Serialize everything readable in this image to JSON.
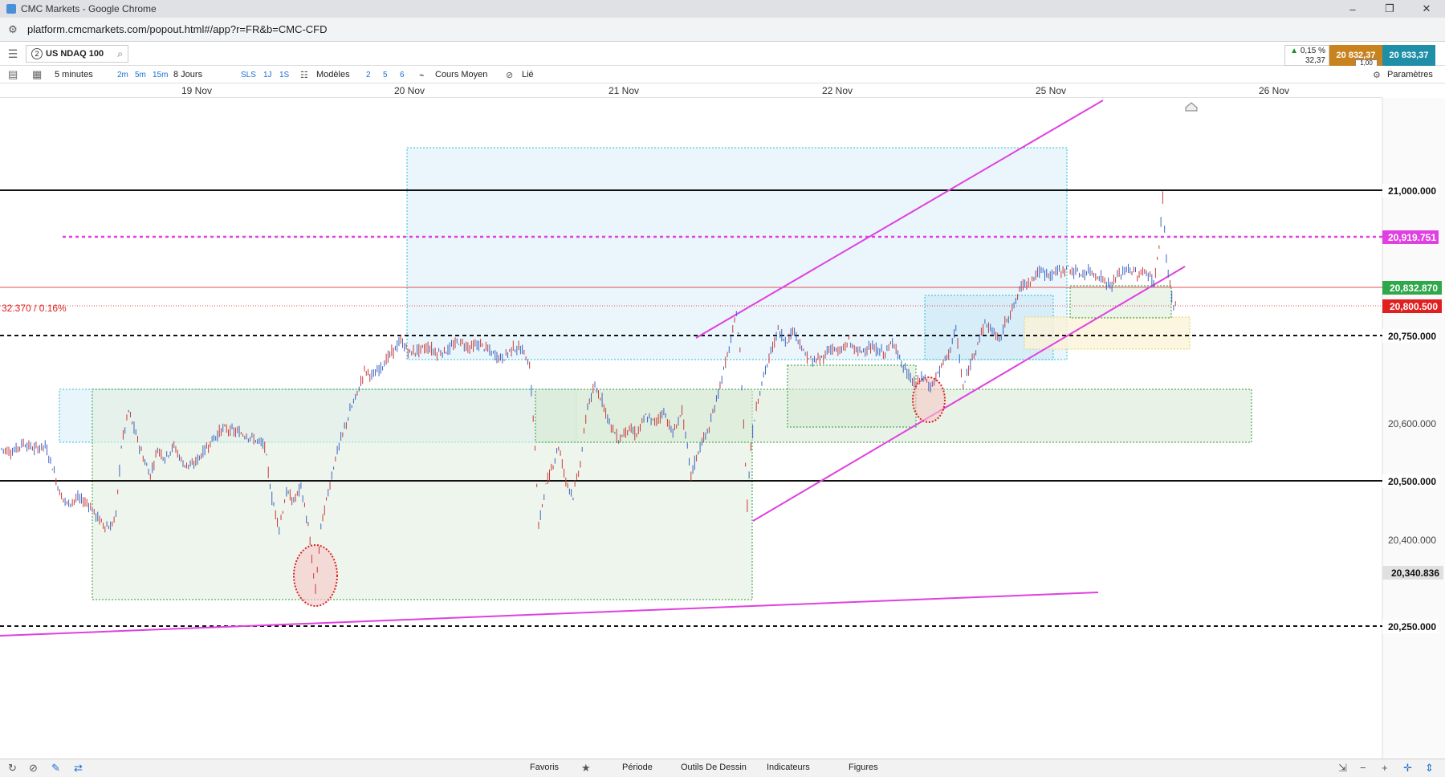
{
  "window": {
    "title": "CMC Markets - Google Chrome"
  },
  "browser": {
    "url": "platform.cmcmarkets.com/popout.html#/app?r=FR&b=CMC-CFD"
  },
  "instrument": {
    "badge": "2",
    "symbol": "US NDAQ 100"
  },
  "quote": {
    "change_pct": "0,15 %",
    "change_abs": "32,37",
    "sell": "20 832,37",
    "buy": "20 833,37",
    "spread": "1,00",
    "colors": {
      "up": "#1a8f2a",
      "sell": "#c8831e",
      "buy": "#1f8fa8"
    }
  },
  "toolbar": {
    "interval": "5 minutes",
    "quick_intervals": [
      "2m",
      "5m",
      "15m"
    ],
    "range": "8 Jours",
    "quick_ranges": [
      "SLS",
      "1J",
      "1S"
    ],
    "templates": "Modèles",
    "layouts": [
      "2",
      "5",
      "6"
    ],
    "price_type": "Cours Moyen",
    "linked": "Lié",
    "settings": "Paramètres"
  },
  "date_axis": [
    "19 Nov",
    "20 Nov",
    "21 Nov",
    "22 Nov",
    "25 Nov",
    "26 Nov"
  ],
  "chart_data": {
    "type": "candlestick",
    "xlabel": "",
    "ylabel": "",
    "x_ticks": [
      "19 Nov",
      "20 Nov",
      "21 Nov",
      "22 Nov",
      "25 Nov",
      "26 Nov"
    ],
    "y_ticks": [
      20400,
      20500,
      20600
    ],
    "ylim": [
      20235,
      21100
    ],
    "price_labels": [
      {
        "value": "21,000.000",
        "style": "black-line"
      },
      {
        "value": "20,919.751",
        "style": "magenta-dashed"
      },
      {
        "value": "20,832.870",
        "style": "green-current"
      },
      {
        "value": "20,800.500",
        "style": "red-reference"
      },
      {
        "value": "20,750.000",
        "style": "black-dashed"
      },
      {
        "value": "20,600.000",
        "style": "tick"
      },
      {
        "value": "20,500.000",
        "style": "black-line"
      },
      {
        "value": "20,400.000",
        "style": "tick"
      },
      {
        "value": "20,340.836",
        "style": "gray-marker"
      },
      {
        "value": "20,250.000",
        "style": "black-dashed"
      }
    ],
    "change_annotation": "32.370 / 0.16%",
    "series": [
      {
        "values": [
          [
            0,
            20555
          ],
          [
            12,
            20550
          ],
          [
            24,
            20565
          ],
          [
            36,
            20555
          ],
          [
            48,
            20560
          ],
          [
            56,
            20525
          ],
          [
            64,
            20480
          ],
          [
            72,
            20460
          ],
          [
            84,
            20470
          ],
          [
            96,
            20460
          ],
          [
            104,
            20440
          ],
          [
            112,
            20425
          ],
          [
            120,
            20420
          ],
          [
            126,
            20440
          ],
          [
            132,
            20560
          ],
          [
            140,
            20620
          ],
          [
            148,
            20580
          ],
          [
            156,
            20540
          ],
          [
            164,
            20510
          ],
          [
            172,
            20555
          ],
          [
            180,
            20540
          ],
          [
            190,
            20560
          ],
          [
            200,
            20530
          ],
          [
            210,
            20525
          ],
          [
            220,
            20545
          ],
          [
            232,
            20570
          ],
          [
            244,
            20590
          ],
          [
            256,
            20585
          ],
          [
            268,
            20580
          ],
          [
            280,
            20570
          ],
          [
            290,
            20560
          ],
          [
            298,
            20470
          ],
          [
            306,
            20420
          ],
          [
            314,
            20480
          ],
          [
            322,
            20465
          ],
          [
            330,
            20490
          ],
          [
            338,
            20420
          ],
          [
            346,
            20310
          ],
          [
            352,
            20420
          ],
          [
            360,
            20480
          ],
          [
            368,
            20540
          ],
          [
            376,
            20580
          ],
          [
            384,
            20620
          ],
          [
            392,
            20650
          ],
          [
            400,
            20690
          ],
          [
            410,
            20680
          ],
          [
            420,
            20700
          ],
          [
            430,
            20720
          ],
          [
            440,
            20740
          ],
          [
            450,
            20720
          ],
          [
            460,
            20725
          ],
          [
            470,
            20730
          ],
          [
            480,
            20720
          ],
          [
            492,
            20725
          ],
          [
            504,
            20740
          ],
          [
            516,
            20730
          ],
          [
            528,
            20735
          ],
          [
            540,
            20720
          ],
          [
            552,
            20710
          ],
          [
            564,
            20730
          ],
          [
            574,
            20725
          ],
          [
            582,
            20700
          ],
          [
            588,
            20560
          ],
          [
            592,
            20420
          ],
          [
            598,
            20480
          ],
          [
            606,
            20520
          ],
          [
            614,
            20560
          ],
          [
            622,
            20500
          ],
          [
            630,
            20475
          ],
          [
            638,
            20530
          ],
          [
            646,
            20630
          ],
          [
            654,
            20660
          ],
          [
            662,
            20640
          ],
          [
            670,
            20600
          ],
          [
            680,
            20570
          ],
          [
            690,
            20590
          ],
          [
            700,
            20580
          ],
          [
            710,
            20610
          ],
          [
            720,
            20600
          ],
          [
            730,
            20620
          ],
          [
            740,
            20580
          ],
          [
            750,
            20620
          ],
          [
            760,
            20510
          ],
          [
            770,
            20560
          ],
          [
            780,
            20590
          ],
          [
            788,
            20640
          ],
          [
            796,
            20690
          ],
          [
            804,
            20740
          ],
          [
            810,
            20790
          ],
          [
            814,
            20720
          ],
          [
            818,
            20600
          ],
          [
            822,
            20460
          ],
          [
            826,
            20560
          ],
          [
            832,
            20630
          ],
          [
            840,
            20680
          ],
          [
            848,
            20720
          ],
          [
            856,
            20760
          ],
          [
            864,
            20740
          ],
          [
            874,
            20760
          ],
          [
            884,
            20720
          ],
          [
            894,
            20705
          ],
          [
            904,
            20710
          ],
          [
            914,
            20730
          ],
          [
            924,
            20720
          ],
          [
            934,
            20740
          ],
          [
            944,
            20720
          ],
          [
            954,
            20730
          ],
          [
            964,
            20725
          ],
          [
            974,
            20720
          ],
          [
            984,
            20740
          ],
          [
            992,
            20700
          ],
          [
            1000,
            20680
          ],
          [
            1008,
            20665
          ],
          [
            1016,
            20680
          ],
          [
            1024,
            20660
          ],
          [
            1034,
            20690
          ],
          [
            1044,
            20720
          ],
          [
            1052,
            20760
          ],
          [
            1060,
            20660
          ],
          [
            1068,
            20700
          ],
          [
            1076,
            20740
          ],
          [
            1084,
            20770
          ],
          [
            1092,
            20760
          ],
          [
            1100,
            20740
          ],
          [
            1108,
            20780
          ],
          [
            1116,
            20800
          ],
          [
            1124,
            20835
          ],
          [
            1134,
            20845
          ],
          [
            1144,
            20860
          ],
          [
            1154,
            20855
          ],
          [
            1164,
            20860
          ],
          [
            1176,
            20865
          ],
          [
            1188,
            20855
          ],
          [
            1200,
            20860
          ],
          [
            1212,
            20850
          ],
          [
            1222,
            20835
          ],
          [
            1232,
            20855
          ],
          [
            1242,
            20865
          ],
          [
            1252,
            20855
          ],
          [
            1262,
            20860
          ],
          [
            1270,
            20840
          ],
          [
            1276,
            20900
          ],
          [
            1280,
            20990
          ],
          [
            1284,
            20880
          ],
          [
            1288,
            20840
          ],
          [
            1292,
            20795
          ],
          [
            1296,
            20820
          ]
        ]
      }
    ],
    "lines": [
      {
        "name": "upper-channel",
        "color": "#e040e0"
      },
      {
        "name": "lower-channel",
        "color": "#e040e0"
      },
      {
        "name": "long-support",
        "color": "#e040e0"
      }
    ]
  },
  "bottombar": {
    "tabs": [
      "Favoris",
      "Période",
      "Outils De Dessin",
      "Indicateurs",
      "Figures"
    ]
  }
}
